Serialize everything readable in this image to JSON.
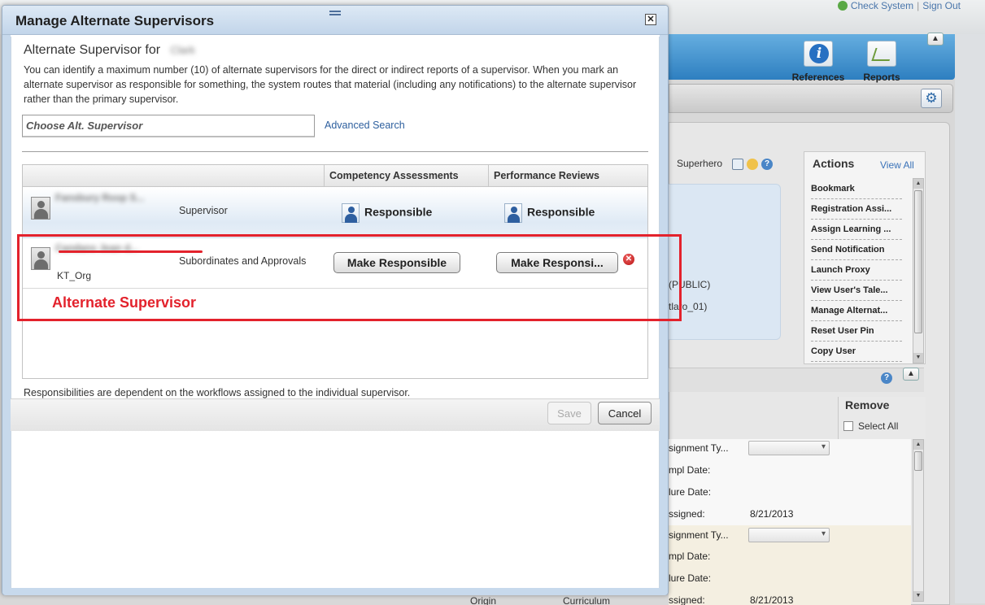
{
  "background": {
    "top_links": {
      "check_system": "Check System",
      "sign_out": "Sign Out"
    },
    "ribbon": {
      "references_label": "References",
      "reports_label": "Reports"
    },
    "superhero_label": "Superhero",
    "super_rows": [
      "(PUBLIC)",
      "tlaro_01)"
    ],
    "actions": {
      "title": "Actions",
      "view_all": "View All",
      "items": [
        "Bookmark",
        "Registration Assi...",
        "Assign Learning ...",
        "Send Notification",
        "Launch Proxy",
        "View User's Tale...",
        "Manage Alternat...",
        "Reset User Pin",
        "Copy User"
      ]
    },
    "remove": {
      "title": "Remove",
      "select_all": "Select All"
    },
    "details": [
      {
        "label": "signment Ty...",
        "value": ""
      },
      {
        "label": "mpl Date:",
        "value": ""
      },
      {
        "label": "lure Date:",
        "value": ""
      },
      {
        "label": "ssigned:",
        "value": "8/21/2013"
      },
      {
        "label": "signment Ty...",
        "value": ""
      },
      {
        "label": "mpl Date:",
        "value": ""
      },
      {
        "label": "lure Date:",
        "value": ""
      },
      {
        "label": "ssigned:",
        "value": "8/21/2013"
      }
    ],
    "footer_cut": [
      "Origin",
      "Curriculum"
    ]
  },
  "dialog": {
    "title": "Manage Alternate Supervisors",
    "alt_supervisor_for_label": "Alternate Supervisor for",
    "alt_supervisor_for_name": "Clark",
    "intro": "You can identify a maximum number (10) of alternate supervisors for the direct or indirect reports of a supervisor. When you mark an alternate supervisor as responsible for something, the system routes that material (including any notifications) to the alternate supervisor rather than the primary supervisor.",
    "search_placeholder": "Choose Alt. Supervisor",
    "advanced_search": "Advanced Search",
    "columns": {
      "competency": "Competency Assessments",
      "performance": "Performance Reviews"
    },
    "rows": [
      {
        "name": "Fansbury Roop S...",
        "role": "Supervisor",
        "org": "",
        "competency": "Responsible",
        "performance": "Responsible"
      },
      {
        "name": "Candans Jean d...",
        "role": "Subordinates and Approvals",
        "org": "KT_Org",
        "competency": "Make Responsible",
        "performance": "Make Responsi..."
      }
    ],
    "annotation": "Alternate Supervisor",
    "note": "Responsibilities are dependent on the workflows assigned to the individual supervisor.",
    "save": "Save",
    "cancel": "Cancel"
  }
}
